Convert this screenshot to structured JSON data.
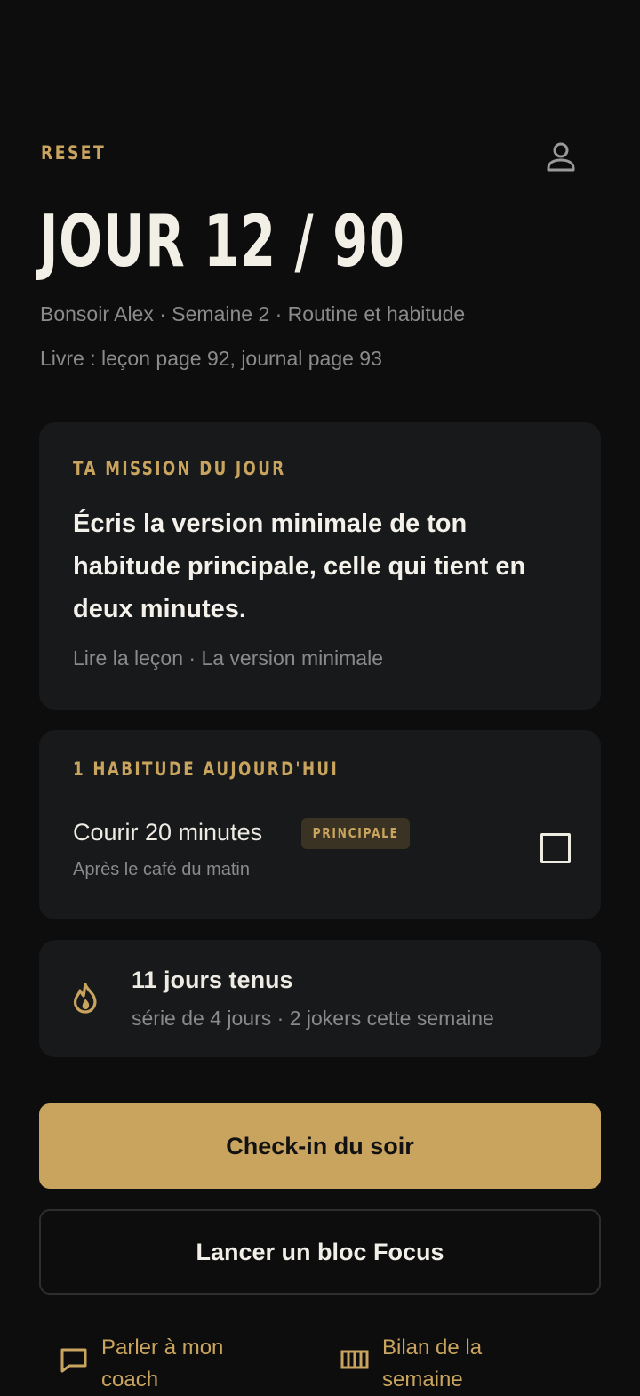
{
  "header": {
    "app_name": "RESET",
    "profile_icon": "profile-icon"
  },
  "hero": {
    "day_title": "JOUR 12 / 90",
    "greeting_line": "Bonsoir Alex · Semaine 2 · Routine et habitude",
    "book_line": "Livre : leçon page 92, journal page 93"
  },
  "mission": {
    "label": "TA MISSION DU JOUR",
    "text": "Écris la version minimale de ton habitude principale, celle qui tient en deux minutes.",
    "lesson_link": "Lire la leçon · La version minimale"
  },
  "habits": {
    "label": "1 HABITUDE AUJOURD'HUI",
    "items": [
      {
        "name": "Courir 20 minutes",
        "badge": "PRINCIPALE",
        "description": "Après le café du matin",
        "checked": false
      }
    ]
  },
  "streak": {
    "icon": "flame-icon",
    "title": "11 jours tenus",
    "subtitle": "série de 4 jours · 2 jokers cette semaine"
  },
  "actions": {
    "primary_label": "Check-in du soir",
    "secondary_label": "Lancer un bloc Focus"
  },
  "bottom_links": [
    {
      "icon": "chat-icon",
      "label": "Parler à mon coach"
    },
    {
      "icon": "calendar-columns-icon",
      "label": "Bilan de la semaine"
    }
  ],
  "colors": {
    "background": "#0d0d0d",
    "card": "#18191b",
    "accent": "#c9a45e",
    "text": "#efece4",
    "muted": "#8a8a8a"
  }
}
